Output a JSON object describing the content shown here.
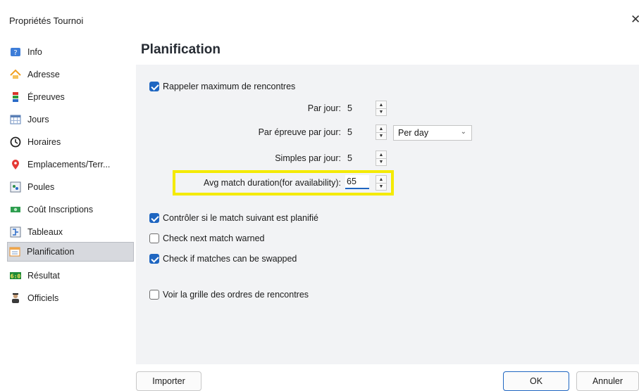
{
  "window": {
    "title": "Propriétés Tournoi",
    "close_glyph": "✕"
  },
  "sidebar": {
    "items": [
      {
        "label": "Info",
        "icon": "info-icon"
      },
      {
        "label": "Adresse",
        "icon": "home-icon"
      },
      {
        "label": "Épreuves",
        "icon": "events-icon"
      },
      {
        "label": "Jours",
        "icon": "calendar-icon"
      },
      {
        "label": "Horaires",
        "icon": "clock-icon"
      },
      {
        "label": "Emplacements/Terr...",
        "icon": "location-pin-icon"
      },
      {
        "label": "Poules",
        "icon": "groups-icon"
      },
      {
        "label": "Coût Inscriptions",
        "icon": "money-icon"
      },
      {
        "label": "Tableaux",
        "icon": "draw-icon"
      },
      {
        "label": "Planification",
        "icon": "planning-icon",
        "selected": true
      },
      {
        "label": "Résultat",
        "icon": "score-icon"
      },
      {
        "label": "Officiels",
        "icon": "official-icon"
      }
    ]
  },
  "main": {
    "title": "Planification",
    "recall_max_matches": {
      "label": "Rappeler maximum de rencontres",
      "checked": true
    },
    "per_day": {
      "label": "Par jour:",
      "value": "5"
    },
    "per_event_per_day": {
      "label": "Par épreuve par jour:",
      "value": "5",
      "dropdown_value": "Per day"
    },
    "singles_per_day": {
      "label": "Simples par jour:",
      "value": "5"
    },
    "avg_duration": {
      "label": "Avg match duration(for availability):",
      "value": "65"
    },
    "check_next_scheduled": {
      "label": "Contrôler si le match suivant est planifié",
      "checked": true
    },
    "check_next_warned": {
      "label": "Check next match warned",
      "checked": false
    },
    "check_swap": {
      "label": "Check if matches can be swapped",
      "checked": true
    },
    "show_order_grid": {
      "label": "Voir la grille des ordres de rencontres",
      "checked": false
    }
  },
  "footer": {
    "import_label": "Importer",
    "ok_label": "OK",
    "cancel_label": "Annuler"
  },
  "colors": {
    "accent": "#1f66c1",
    "highlight": "#f4ea00",
    "selected_bg": "#d7d9de"
  }
}
